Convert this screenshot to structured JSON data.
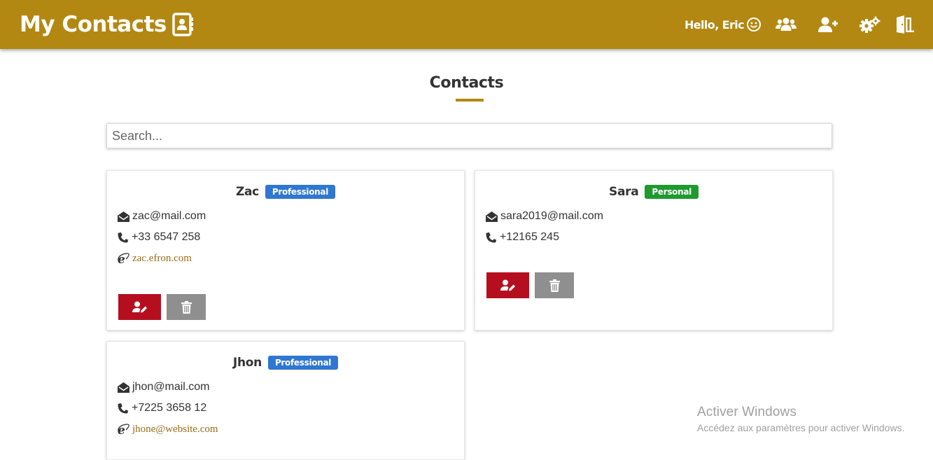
{
  "header": {
    "brand": "My Contacts",
    "greeting": "Hello, Eric",
    "icons": [
      "users-icon",
      "add-user-icon",
      "settings-icon",
      "logout-icon"
    ]
  },
  "page": {
    "title": "Contacts"
  },
  "search": {
    "placeholder": "Search...",
    "value": ""
  },
  "contacts": [
    {
      "name": "Zac",
      "type": "Professional",
      "email": "zac@mail.com",
      "phone": "+33 6547 258",
      "website": "zac.efron.com"
    },
    {
      "name": "Sara",
      "type": "Personal",
      "email": "sara2019@mail.com",
      "phone": "+12165 245"
    },
    {
      "name": "Jhon",
      "type": "Professional",
      "email": "jhon@mail.com",
      "phone": "+7225 3658 12",
      "website": "jhone@website.com"
    }
  ],
  "colors": {
    "accent": "#b38812",
    "professional": "#2f77d1",
    "personal": "#1e9a2f",
    "edit_button": "#b50f1f",
    "delete_button": "#8f8f8f"
  },
  "watermark": {
    "title": "Activer Windows",
    "subtitle": "Accédez aux paramètres pour activer Windows."
  }
}
